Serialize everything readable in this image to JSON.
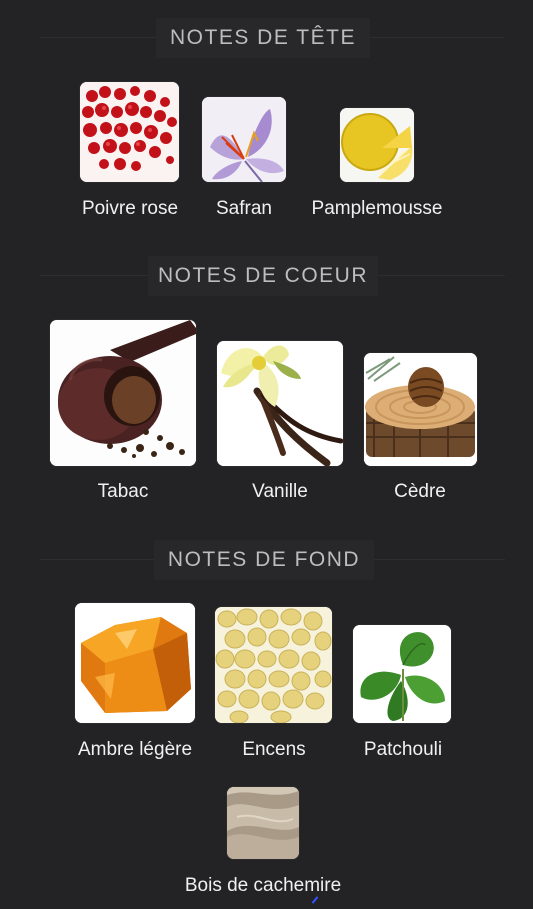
{
  "sections": [
    {
      "title": "NOTES DE TÊTE",
      "notes": [
        {
          "label": "Poivre rose",
          "icon": "pink-pepper-image"
        },
        {
          "label": "Safran",
          "icon": "saffron-image"
        },
        {
          "label": "Pamplemousse",
          "icon": "grapefruit-image"
        }
      ]
    },
    {
      "title": "NOTES DE COEUR",
      "notes": [
        {
          "label": "Tabac",
          "icon": "tobacco-pipe-image"
        },
        {
          "label": "Vanille",
          "icon": "vanilla-image"
        },
        {
          "label": "Cèdre",
          "icon": "cedar-image"
        }
      ]
    },
    {
      "title": "NOTES DE FOND",
      "notes": [
        {
          "label": "Ambre légère",
          "icon": "amber-image"
        },
        {
          "label": "Encens",
          "icon": "incense-image"
        },
        {
          "label": "Patchouli",
          "icon": "patchouli-image"
        },
        {
          "label": "Bois de cachemire",
          "icon": "cashmere-wood-image"
        }
      ]
    }
  ],
  "colors": {
    "background": "#232325",
    "header_pill": "#28282b",
    "header_text": "#bdbdbd",
    "label_text": "#f0f0f0"
  }
}
